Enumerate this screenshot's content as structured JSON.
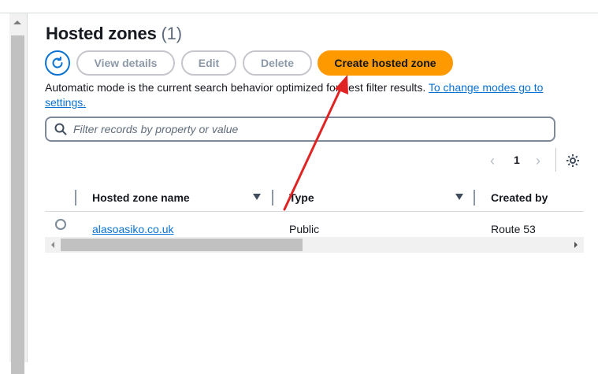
{
  "header": {
    "title": "Hosted zones",
    "count": "(1)"
  },
  "toolbar": {
    "view_details": "View details",
    "edit": "Edit",
    "delete": "Delete",
    "create": "Create hosted zone"
  },
  "info": {
    "text": "Automatic mode is the current search behavior optimized for best filter results.",
    "link": "To change modes go to settings."
  },
  "filter": {
    "placeholder": "Filter records by property or value"
  },
  "pagination": {
    "current_page": "1",
    "prev": "‹",
    "next": "›"
  },
  "table": {
    "columns": [
      "Hosted zone name",
      "Type",
      "Created by"
    ],
    "rows": [
      {
        "name": "alasoasiko.co.uk",
        "type": "Public",
        "created_by": "Route 53"
      }
    ]
  },
  "colors": {
    "accent": "#0972d3",
    "primary_button": "#ff9900",
    "annotation_arrow": "#e02424"
  },
  "icons": [
    "refresh-icon",
    "search-icon",
    "settings-gear-icon",
    "annotation-arrow"
  ]
}
